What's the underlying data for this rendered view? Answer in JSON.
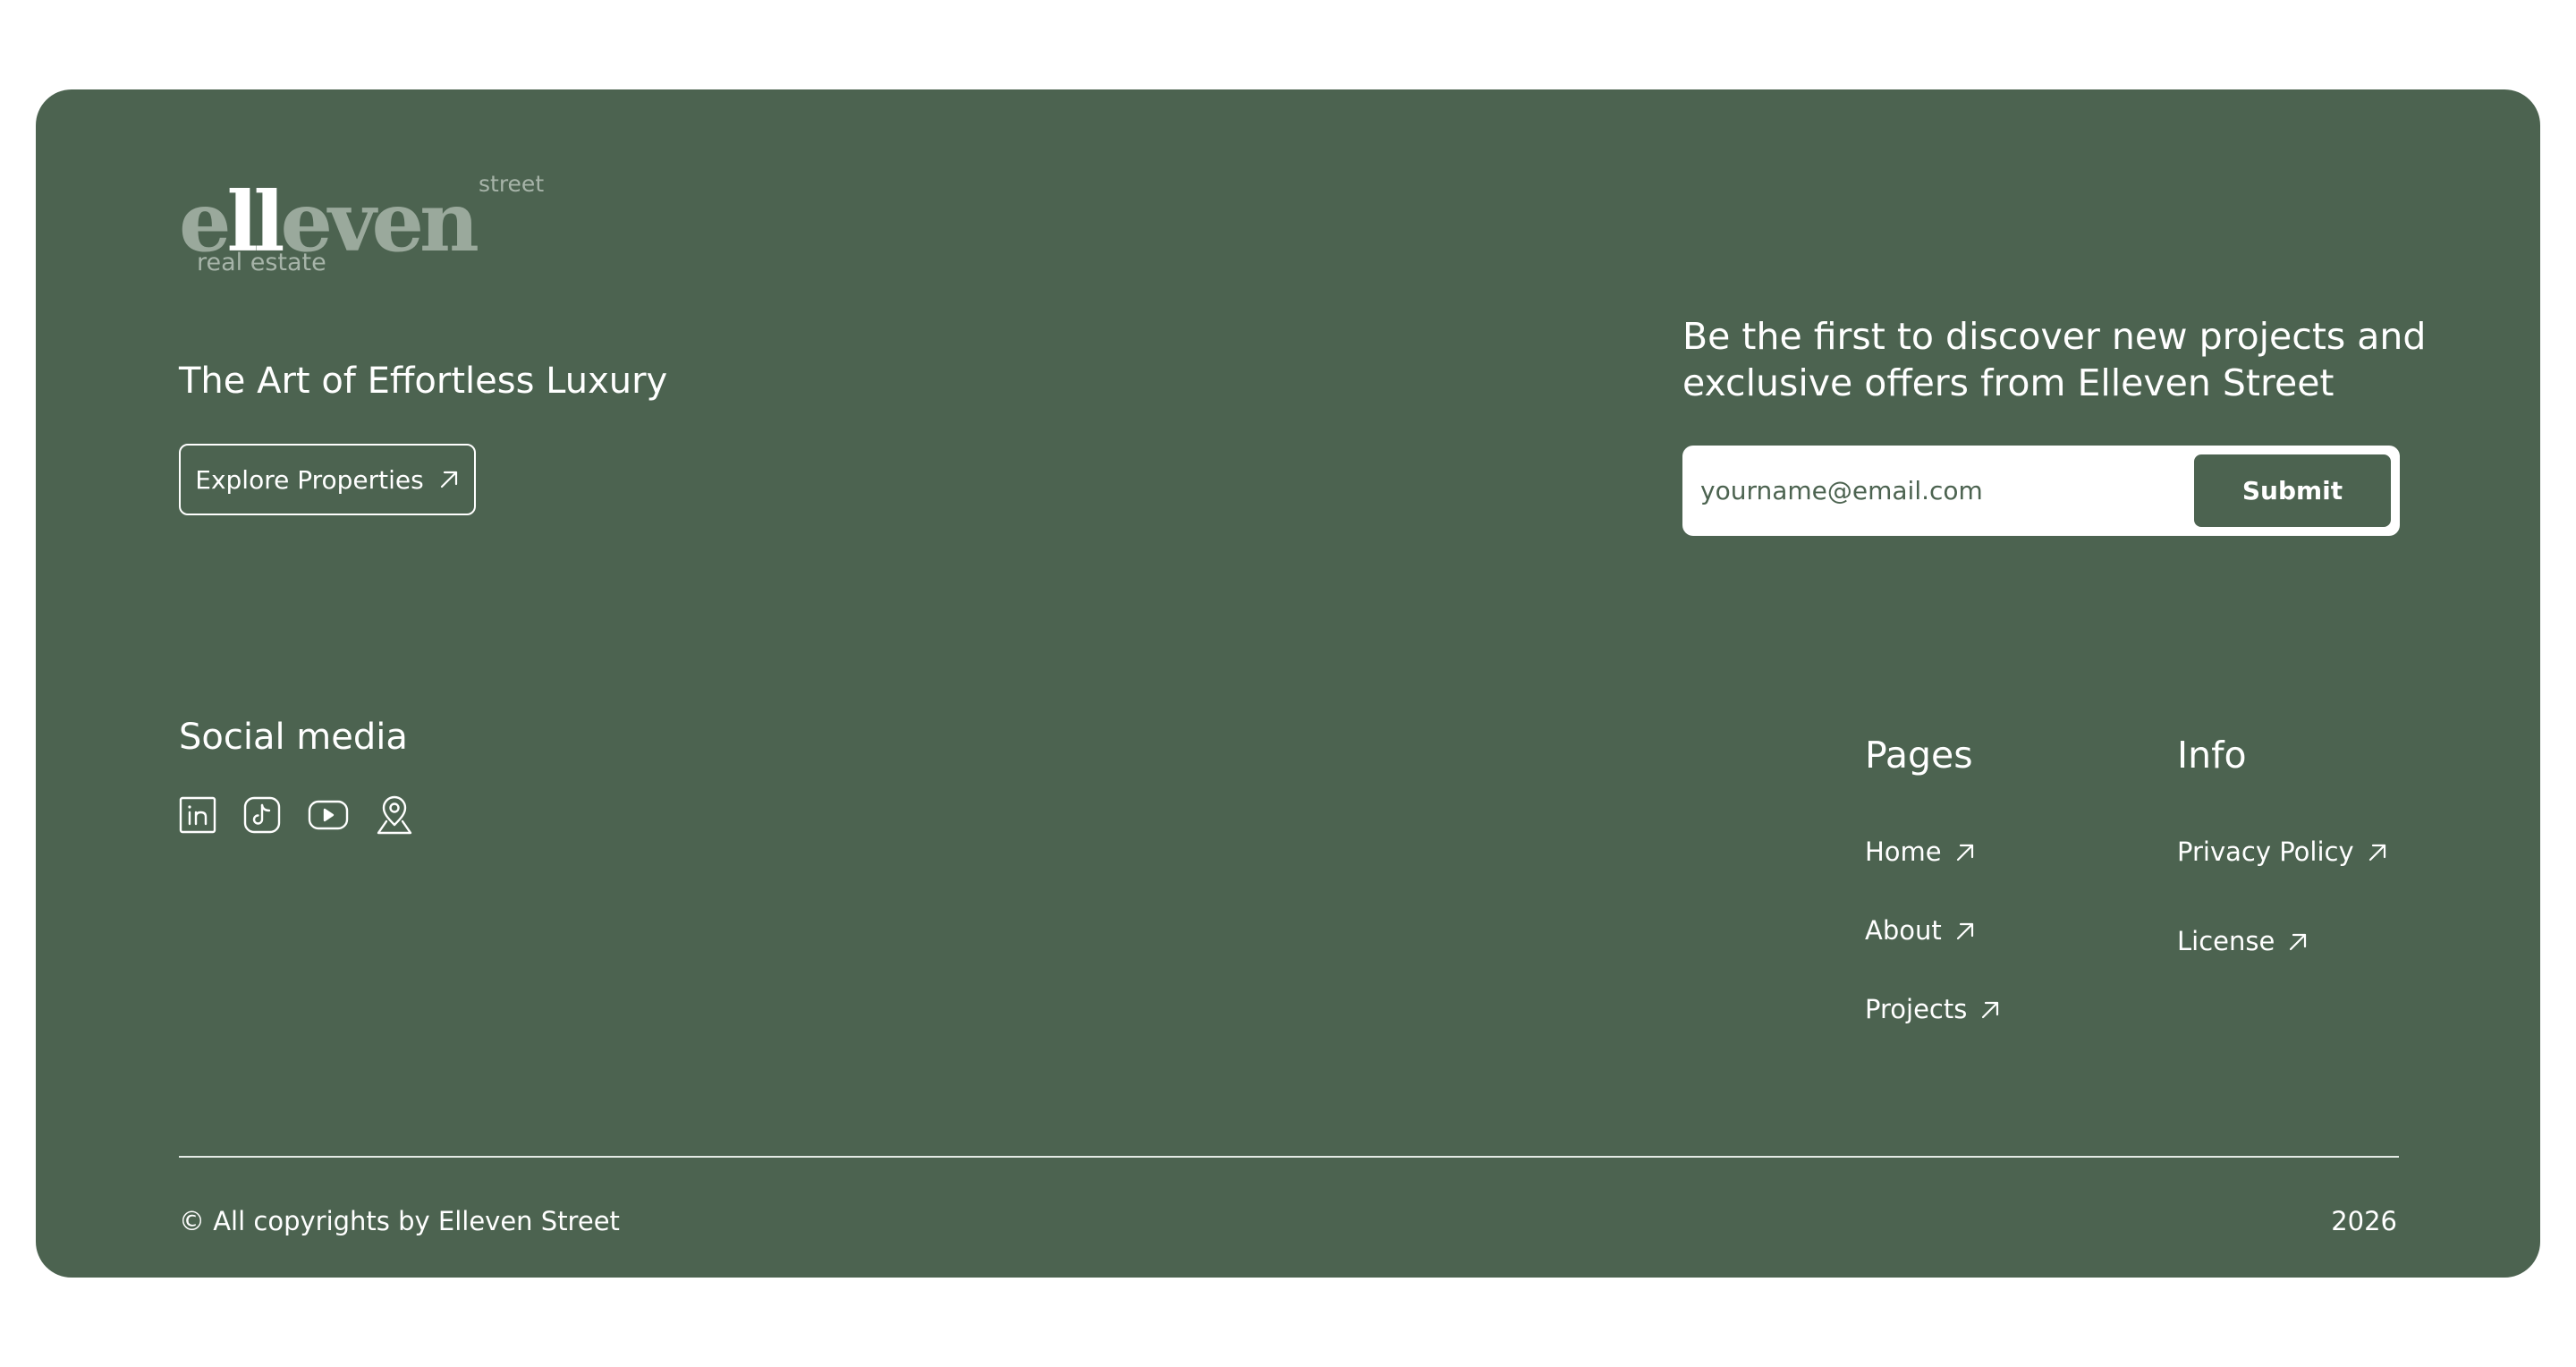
{
  "brand": {
    "logo_word": "elleven",
    "logo_street": "street",
    "logo_subtitle": "real estate"
  },
  "hero": {
    "tagline": "The Art of Effortless Luxury",
    "explore_label": "Explore Properties"
  },
  "newsletter": {
    "heading": "Be the first to discover new projects and exclusive offers from Elleven Street",
    "email_placeholder": "yourname@email.com",
    "submit_label": "Submit"
  },
  "social": {
    "title": "Social media",
    "icons": [
      "linkedin-icon",
      "tiktok-icon",
      "youtube-icon",
      "location-pin-icon"
    ]
  },
  "pages": {
    "title": "Pages",
    "links": [
      {
        "label": "Home"
      },
      {
        "label": "About"
      },
      {
        "label": "Projects"
      }
    ]
  },
  "info": {
    "title": "Info",
    "links": [
      {
        "label": "Privacy Policy"
      },
      {
        "label": "License"
      }
    ]
  },
  "bottom": {
    "copyright": "© All copyrights by Elleven Street",
    "year": "2026"
  },
  "colors": {
    "footer_bg": "#4c6350",
    "text": "#ffffff",
    "logo_muted": "#9aa99c"
  }
}
